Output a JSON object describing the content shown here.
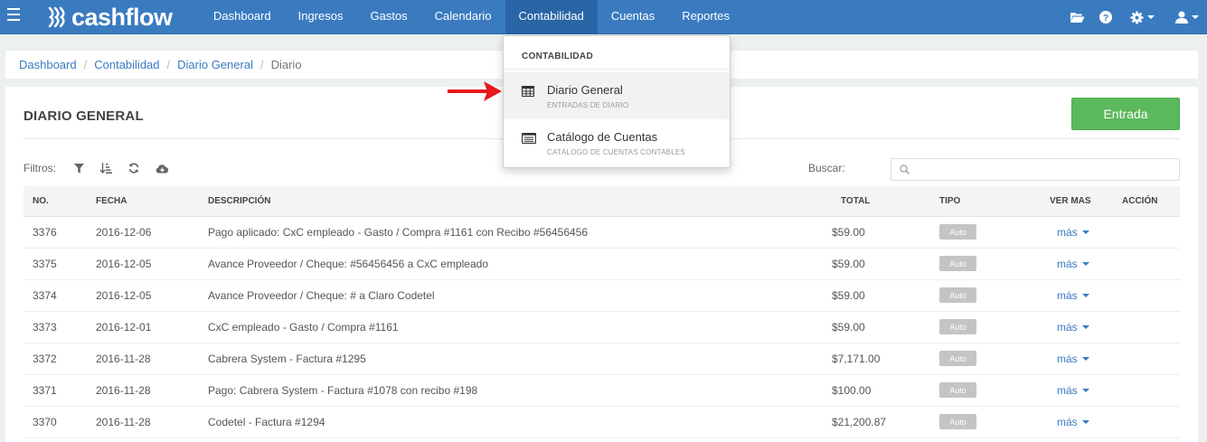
{
  "app": {
    "brand": "cashflow"
  },
  "nav": {
    "items": [
      {
        "label": "Dashboard",
        "active": false
      },
      {
        "label": "Ingresos",
        "active": false
      },
      {
        "label": "Gastos",
        "active": false
      },
      {
        "label": "Calendario",
        "active": false
      },
      {
        "label": "Contabilidad",
        "active": true
      },
      {
        "label": "Cuentas",
        "active": false
      },
      {
        "label": "Reportes",
        "active": false
      }
    ],
    "right_icons": [
      "folder-open-icon",
      "question-circle-icon",
      "gear-icon",
      "user-icon"
    ]
  },
  "breadcrumb": [
    "Dashboard",
    "Contabilidad",
    "Diario General",
    "Diario"
  ],
  "page": {
    "title": "DIARIO GENERAL",
    "entrada_label": "Entrada",
    "filters_label": "Filtros:",
    "filter_icons": [
      "filter-icon",
      "sort-amount-icon",
      "refresh-icon",
      "cloud-download-icon"
    ],
    "search_label": "Buscar:",
    "search_value": ""
  },
  "table": {
    "headers": [
      "NO.",
      "FECHA",
      "DESCRIPCIÓN",
      "TOTAL",
      "TIPO",
      "VER MAS",
      "ACCIÓN"
    ],
    "rows": [
      {
        "no": "3376",
        "fecha": "2016-12-06",
        "descripcion": "Pago aplicado: CxC empleado - Gasto / Compra #1161 con Recibo #56456456",
        "total": "$59.00",
        "tipo": "Auto",
        "ver_mas": "más"
      },
      {
        "no": "3375",
        "fecha": "2016-12-05",
        "descripcion": "Avance Proveedor / Cheque: #56456456 a CxC empleado",
        "total": "$59.00",
        "tipo": "Auto",
        "ver_mas": "más"
      },
      {
        "no": "3374",
        "fecha": "2016-12-05",
        "descripcion": "Avance Proveedor / Cheque: # a Claro Codetel",
        "total": "$59.00",
        "tipo": "Auto",
        "ver_mas": "más"
      },
      {
        "no": "3373",
        "fecha": "2016-12-01",
        "descripcion": "CxC empleado - Gasto / Compra #1161",
        "total": "$59.00",
        "tipo": "Auto",
        "ver_mas": "más"
      },
      {
        "no": "3372",
        "fecha": "2016-11-28",
        "descripcion": "Cabrera System - Factura #1295",
        "total": "$7,171.00",
        "tipo": "Auto",
        "ver_mas": "más"
      },
      {
        "no": "3371",
        "fecha": "2016-11-28",
        "descripcion": "Pago: Cabrera System - Factura #1078 con recibo #198",
        "total": "$100.00",
        "tipo": "Auto",
        "ver_mas": "más"
      },
      {
        "no": "3370",
        "fecha": "2016-11-28",
        "descripcion": "Codetel - Factura #1294",
        "total": "$21,200.87",
        "tipo": "Auto",
        "ver_mas": "más"
      }
    ]
  },
  "dropdown": {
    "header": "CONTABILIDAD",
    "items": [
      {
        "label": "Diario General",
        "sub": "ENTRADAS DE DIARIO",
        "icon": "table-icon"
      },
      {
        "label": "Catálogo de Cuentas",
        "sub": "CATÁLOGO DE CUENTAS CONTABLES",
        "icon": "list-alt-icon"
      }
    ]
  },
  "colors": {
    "navbar": "#3a7bc0",
    "nav_active": "#2a65a6",
    "success": "#5cb85c",
    "link": "#3a7bc0",
    "annotation_arrow": "#e8181b"
  }
}
